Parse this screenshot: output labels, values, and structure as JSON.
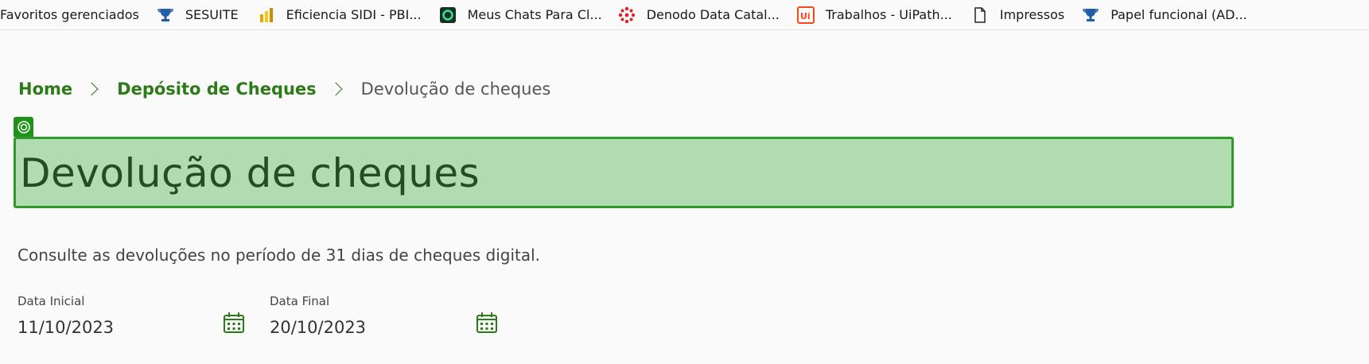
{
  "bookmarks": [
    {
      "label": "Favoritos gerenciados",
      "icon": "folder-icon"
    },
    {
      "label": "SESUITE",
      "icon": "trophy-icon"
    },
    {
      "label": "Eficiencia SIDI - PBI...",
      "icon": "powerbi-icon"
    },
    {
      "label": "Meus Chats Para Cl...",
      "icon": "chat-app-icon"
    },
    {
      "label": "Denodo Data Catal...",
      "icon": "denodo-icon"
    },
    {
      "label": "Trabalhos - UiPath...",
      "icon": "uipath-icon"
    },
    {
      "label": "Impressos",
      "icon": "page-icon"
    },
    {
      "label": "Papel funcional (AD...",
      "icon": "trophy-icon"
    }
  ],
  "breadcrumb": {
    "home": "Home",
    "section": "Depósito de Cheques",
    "current": "Devolução de cheques"
  },
  "page": {
    "title": "Devolução de cheques",
    "subtitle": "Consulte as devoluções no período de 31 dias de cheques digital."
  },
  "filters": {
    "start_label": "Data Inicial",
    "start_value": "11/10/2023",
    "end_label": "Data Final",
    "end_value": "20/10/2023"
  },
  "colors": {
    "accent": "#2d7a19",
    "highlight_fill": "#b1dbb1",
    "highlight_border": "#2f9a2a"
  }
}
